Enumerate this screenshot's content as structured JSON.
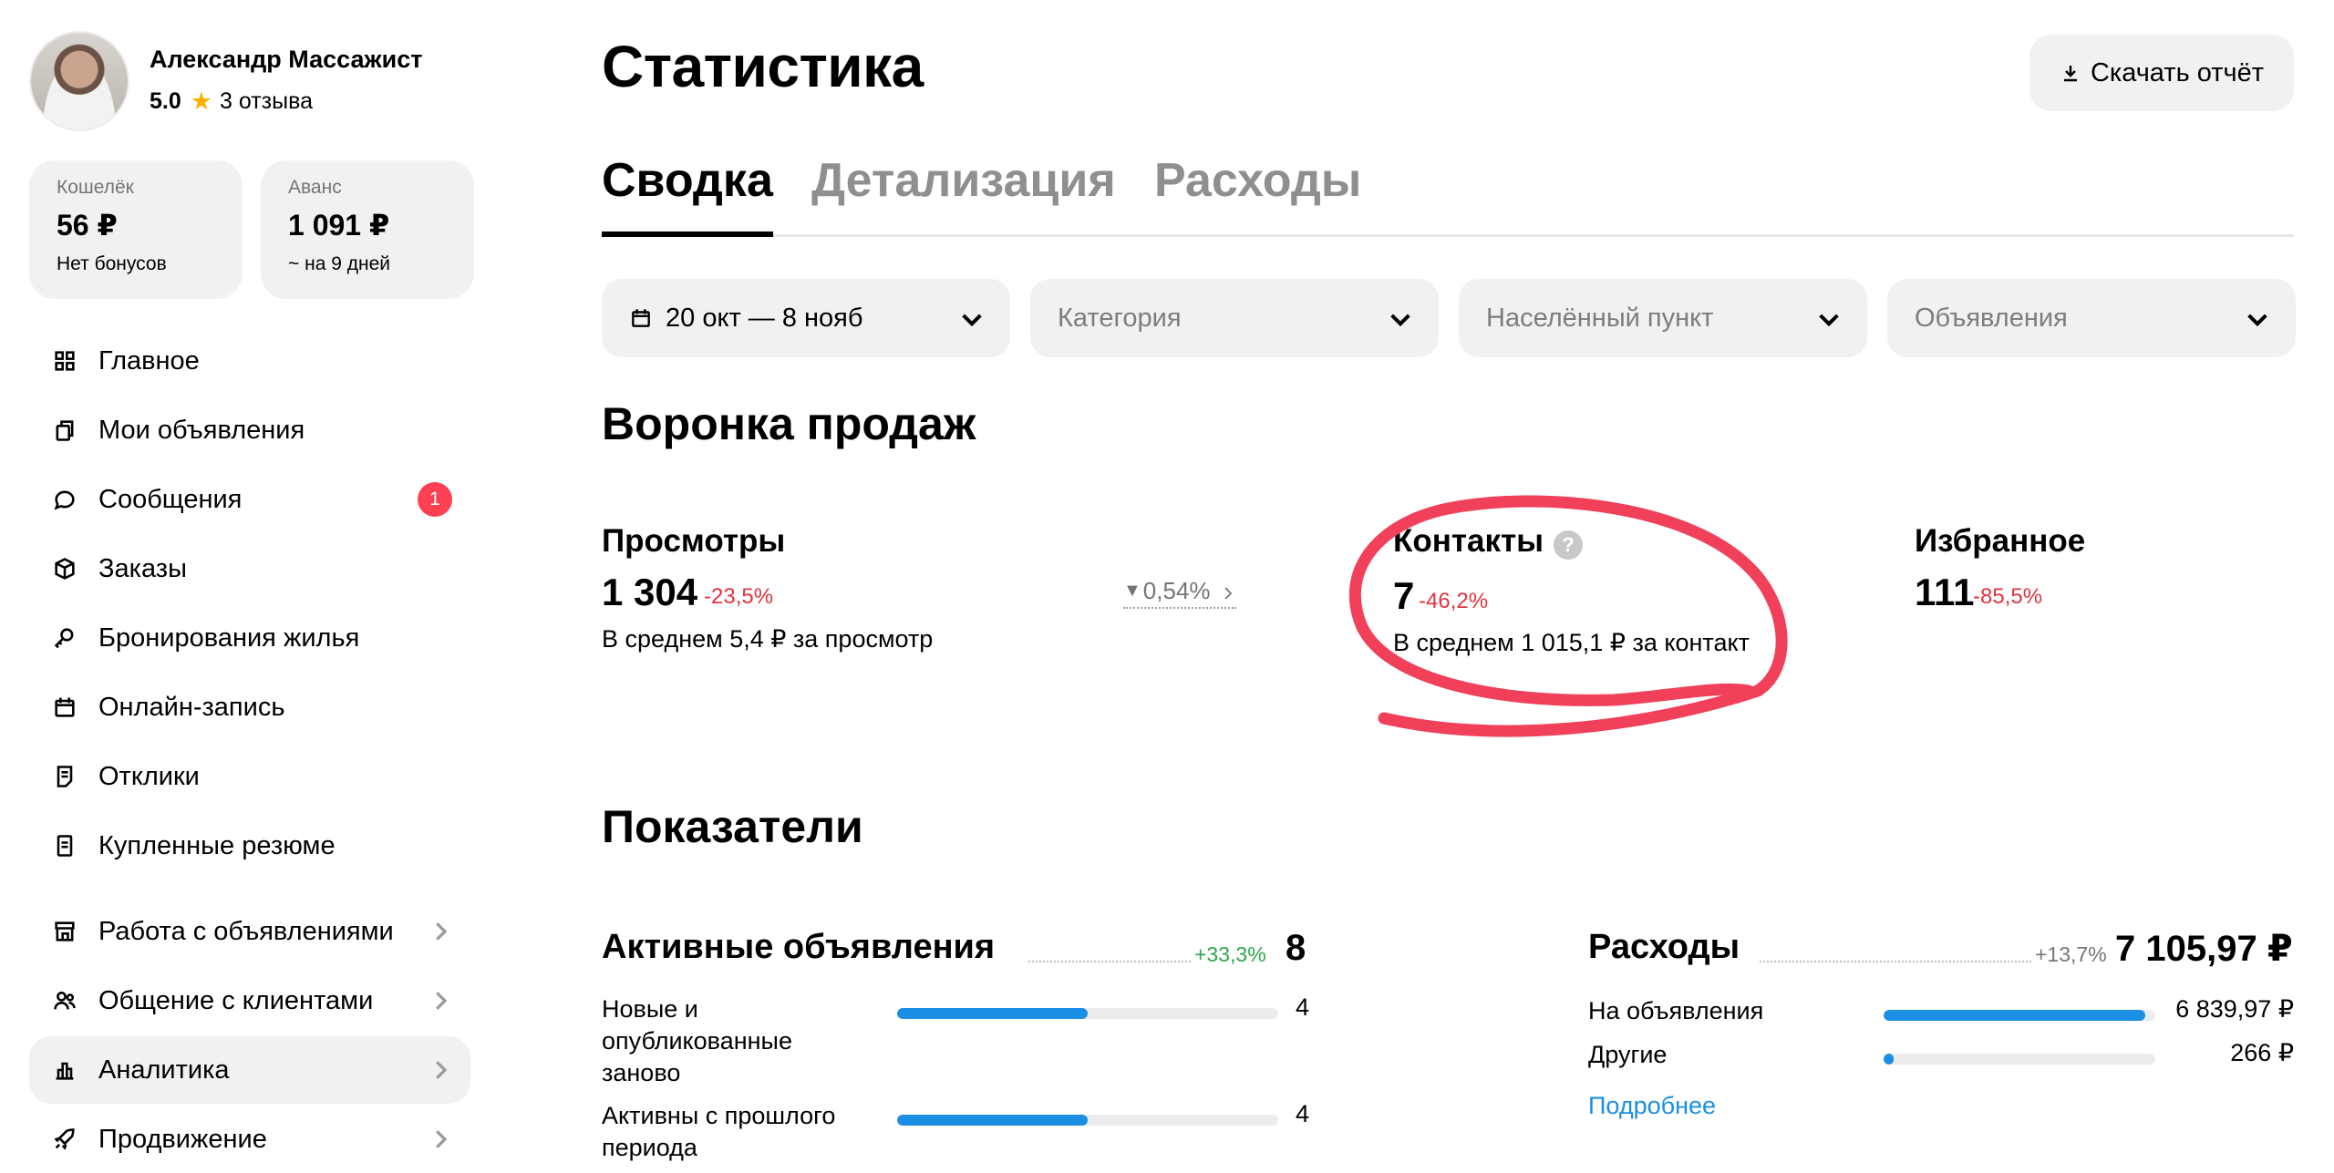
{
  "profile": {
    "name": "Александр Массажист",
    "rating": "5.0",
    "reviews": "3 отзыва"
  },
  "wallet": {
    "label": "Кошелёк",
    "amount": "56 ₽",
    "sub": "Нет бонусов"
  },
  "advance": {
    "label": "Аванс",
    "amount": "1 091 ₽",
    "sub": "~ на 9 дней"
  },
  "nav": [
    {
      "label": "Главное",
      "icon": "grid-icon"
    },
    {
      "label": "Мои объявления",
      "icon": "copy-icon"
    },
    {
      "label": "Сообщения",
      "icon": "chat-bubble-icon",
      "badge": "1"
    },
    {
      "label": "Заказы",
      "icon": "box-icon"
    },
    {
      "label": "Бронирования жилья",
      "icon": "key-icon"
    },
    {
      "label": "Онлайн-запись",
      "icon": "calendar-icon"
    },
    {
      "label": "Отклики",
      "icon": "document-icon"
    },
    {
      "label": "Купленные резюме",
      "icon": "resume-icon"
    },
    {
      "label": "Работа с объявлениями",
      "icon": "store-icon"
    },
    {
      "label": "Общение с клиентами",
      "icon": "users-icon"
    },
    {
      "label": "Аналитика",
      "icon": "bar-chart-icon",
      "active": true
    },
    {
      "label": "Продвижение",
      "icon": "rocket-icon"
    }
  ],
  "header": {
    "title": "Статистика",
    "download_label": "Скачать отчёт"
  },
  "tabs": [
    "Сводка",
    "Детализация",
    "Расходы"
  ],
  "active_tab": "Сводка",
  "filters": {
    "date": "20 окт — 8 нояб",
    "category_placeholder": "Категория",
    "location_placeholder": "Населённый пункт",
    "ads_placeholder": "Объявления"
  },
  "funnel": {
    "title": "Воронка продаж",
    "views": {
      "label": "Просмотры",
      "value": "1 304",
      "delta": "-23,5%",
      "sub": "В среднем 5,4 ₽ за просмотр"
    },
    "conversion": "0,54%",
    "contacts": {
      "label": "Контакты",
      "help": "?",
      "value": "7",
      "delta": "-46,2%",
      "sub": "В среднем 1 015,1 ₽ за контакт"
    },
    "favorites": {
      "label": "Избранное",
      "value": "111",
      "delta": "-85,5%"
    }
  },
  "indicators": {
    "title": "Показатели",
    "active_ads": {
      "title": "Активные объявления",
      "delta": "+33,3%",
      "total": "8",
      "rows": [
        {
          "label": "Новые и опубликованные заново",
          "value": "4",
          "fraction": 0.5
        },
        {
          "label": "Активны с прошлого периода",
          "value": "4",
          "fraction": 0.5
        }
      ]
    },
    "expenses": {
      "title": "Расходы",
      "delta": "+13,7%",
      "total": "7 105,97 ₽",
      "rows": [
        {
          "label": "На объявления",
          "value": "6 839,97 ₽",
          "fraction": 0.963
        },
        {
          "label": "Другие",
          "value": "266 ₽",
          "fraction": 0.037
        }
      ],
      "more_label": "Подробнее"
    }
  },
  "colors": {
    "accent_blue": "#1a8fe3",
    "negative": "#e0343e",
    "positive": "#2aa84a",
    "badge": "#ff4053",
    "annotation": "#f0405a",
    "surface": "#f2f1f0"
  }
}
